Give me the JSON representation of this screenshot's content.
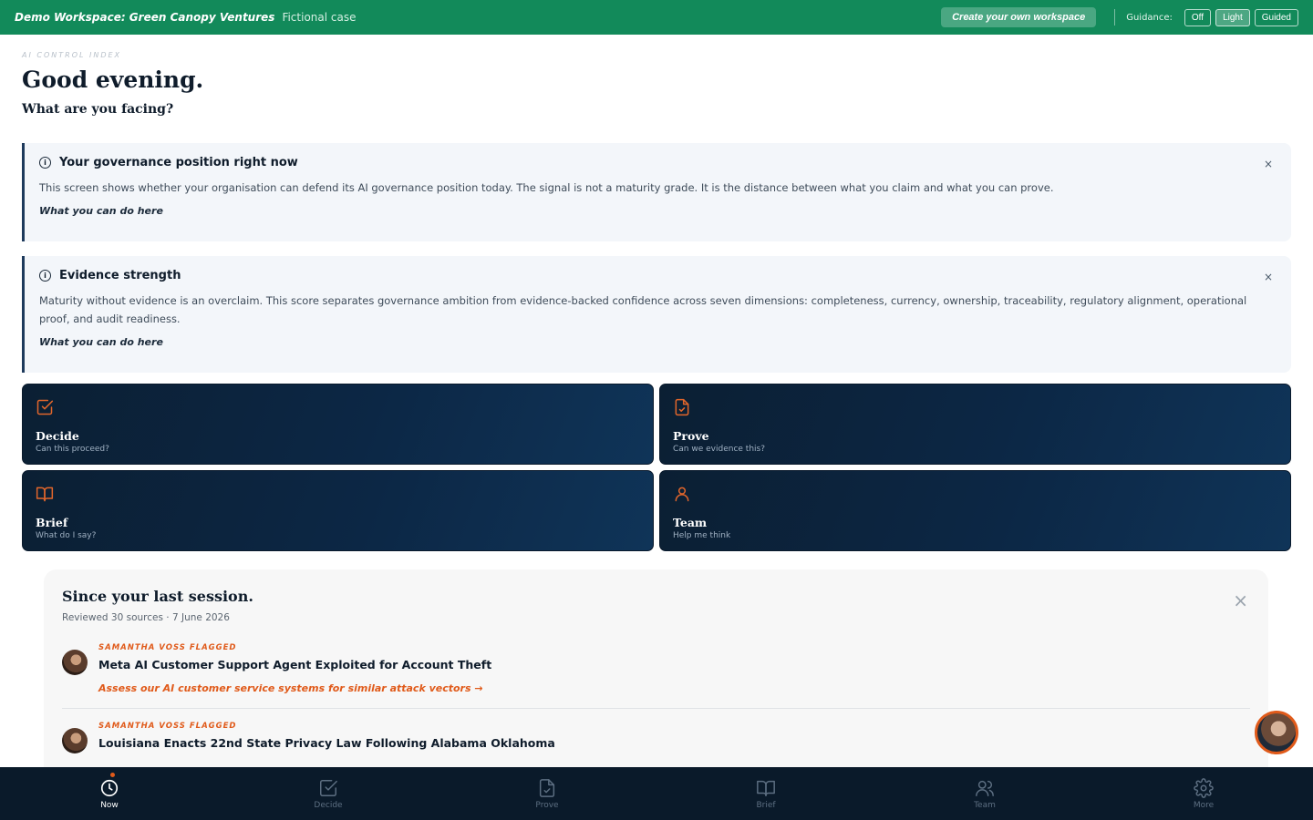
{
  "topbar": {
    "workspace_title": "Demo Workspace: Green Canopy Ventures",
    "workspace_subtitle": "Fictional case",
    "create_button": "Create your own workspace",
    "guidance_label": "Guidance:",
    "guidance_options": [
      "Off",
      "Light",
      "Guided"
    ],
    "guidance_selected": "Light"
  },
  "header": {
    "eyebrow": "AI CONTROL INDEX",
    "greeting": "Good evening.",
    "question": "What are you facing?"
  },
  "info_cards": [
    {
      "title": "Your governance position right now",
      "body": "This screen shows whether your organisation can defend its AI governance position today. The signal is not a maturity grade. It is the distance between what you claim and what you can prove.",
      "cta": "What you can do here",
      "close": "×"
    },
    {
      "title": "Evidence strength",
      "body": "Maturity without evidence is an overclaim. This score separates governance ambition from evidence-backed confidence across seven dimensions: completeness, currency, ownership, traceability, regulatory alignment, operational proof, and audit readiness.",
      "cta": "What you can do here",
      "close": "×"
    }
  ],
  "tiles": [
    {
      "name": "Decide",
      "sub": "Can this proceed?",
      "icon": "check-square-icon"
    },
    {
      "name": "Prove",
      "sub": "Can we evidence this?",
      "icon": "file-check-icon"
    },
    {
      "name": "Brief",
      "sub": "What do I say?",
      "icon": "book-open-icon"
    },
    {
      "name": "Team",
      "sub": "Help me think",
      "icon": "user-icon"
    }
  ],
  "session": {
    "title": "Since your last session.",
    "meta": "Reviewed 30 sources · 7 June 2026",
    "close": "×",
    "items": [
      {
        "flag": "SAMANTHA VOSS FLAGGED",
        "headline": "Meta AI Customer Support Agent Exploited for Account Theft",
        "action": "Assess our AI customer service systems for similar attack vectors →"
      },
      {
        "flag": "SAMANTHA VOSS FLAGGED",
        "headline": "Louisiana Enacts 22nd State Privacy Law Following Alabama Oklahoma",
        "action": ""
      }
    ]
  },
  "bottom_nav": [
    {
      "label": "Now",
      "icon": "clock-icon",
      "active": true
    },
    {
      "label": "Decide",
      "icon": "check-square-icon"
    },
    {
      "label": "Prove",
      "icon": "file-check-icon"
    },
    {
      "label": "Brief",
      "icon": "book-open-icon"
    },
    {
      "label": "Team",
      "icon": "users-icon"
    },
    {
      "label": "More",
      "icon": "gear-icon"
    }
  ],
  "colors": {
    "topbar": "#128a5a",
    "accent": "#e05a1a",
    "navy": "#0a1a2a"
  }
}
